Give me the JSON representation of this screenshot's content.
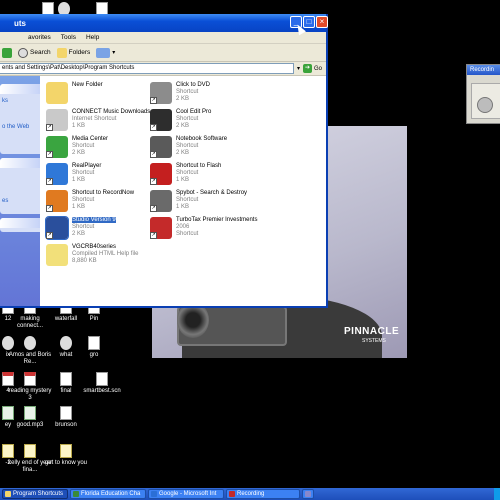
{
  "window": {
    "title_fragment": "uts",
    "menu": [
      "avorites",
      "Tools",
      "Help"
    ],
    "toolbar": {
      "search_label": "Search",
      "folders_label": "Folders"
    },
    "address": "ents and Settings\\Pat\\Desktop\\Program Shortcuts",
    "go_label": "Go",
    "taskpane": {
      "item1": "ks",
      "item2": "o the Web",
      "item3": "es"
    },
    "files": [
      {
        "name": "New Folder",
        "line2": "",
        "line3": "",
        "icon": "folder-icon",
        "color": "#f3d56a"
      },
      {
        "name": "Click to DVD",
        "line2": "Shortcut",
        "line3": "2 KB",
        "icon": "dvd-icon",
        "color": "#8c8c8c"
      },
      {
        "name": "CONNECT Music Downloads",
        "line2": "Internet Shortcut",
        "line3": "1 KB",
        "icon": "music-downloads-icon",
        "color": "#c9c9c9"
      },
      {
        "name": "Cool Edit Pro",
        "line2": "Shortcut",
        "line3": "2 KB",
        "icon": "waveform-icon",
        "color": "#2d2d2d"
      },
      {
        "name": "Media Center",
        "line2": "Shortcut",
        "line3": "2 KB",
        "icon": "media-center-icon",
        "color": "#3aa540"
      },
      {
        "name": "Notebook Software",
        "line2": "Shortcut",
        "line3": "2 KB",
        "icon": "notebook-icon",
        "color": "#5a5a5a"
      },
      {
        "name": "RealPlayer",
        "line2": "Shortcut",
        "line3": "1 KB",
        "icon": "realplayer-icon",
        "color": "#2f78d8"
      },
      {
        "name": "Shortcut to Flash",
        "line2": "Shortcut",
        "line3": "1 KB",
        "icon": "flash-icon",
        "color": "#c41f1f"
      },
      {
        "name": "Shortcut to RecordNow",
        "line2": "Shortcut",
        "line3": "1 KB",
        "icon": "recordnow-icon",
        "color": "#e07a20"
      },
      {
        "name": "Spybot - Search & Destroy",
        "line2": "Shortcut",
        "line3": "1 KB",
        "icon": "spybot-icon",
        "color": "#6a6a6a"
      },
      {
        "name": "Studio Version 9",
        "line2": "Shortcut",
        "line3": "2 KB",
        "icon": "studio-icon",
        "color": "#2a4f9c"
      },
      {
        "name": "TurboTax Premier Investments",
        "line2": "2006",
        "line3": "Shortcut",
        "icon": "turbotax-icon",
        "color": "#c42a2a"
      },
      {
        "name": "VGCRB40series",
        "line2": "Compiled HTML Help file",
        "line3": "8,880 KB",
        "icon": "help-file-icon",
        "color": "#f2e07a"
      }
    ]
  },
  "desktop": {
    "icons": [
      {
        "label": "kelly end of year fina...",
        "icon": "note"
      },
      {
        "label": "get to know you",
        "icon": "note"
      },
      {
        "label": "making connect...",
        "icon": "doc"
      },
      {
        "label": "waterfall",
        "icon": "doc"
      },
      {
        "label": "Pin",
        "icon": "doc"
      },
      {
        "label": "Amos and Boris Re...",
        "icon": "spk"
      },
      {
        "label": "what",
        "icon": "spk"
      },
      {
        "label": "gro",
        "icon": "doc"
      },
      {
        "label": "reading mystery 3",
        "icon": "pdf"
      },
      {
        "label": "final",
        "icon": "doc"
      },
      {
        "label": "smartbest.scn",
        "icon": "doc"
      },
      {
        "label": "good.mp3",
        "icon": "mp3"
      },
      {
        "label": "brunson",
        "icon": "doc"
      }
    ],
    "partial_left_labels": [
      "12",
      "ix",
      "4",
      "ey",
      "-2"
    ]
  },
  "photo": {
    "brand": "PINNACLE",
    "brand_sub": "SYSTEMS"
  },
  "recording": {
    "title": "Recordin"
  },
  "taskbar": {
    "items": [
      {
        "label": "Program Shortcuts",
        "color": "#f3d56a",
        "active": true
      },
      {
        "label": "Florida Education Cha",
        "color": "#3a8a3a",
        "active": false
      },
      {
        "label": "Google - Microsoft Int",
        "color": "#2b6fd6",
        "active": false
      },
      {
        "label": "Recording",
        "color": "#c42a2a",
        "active": false
      },
      {
        "label": "",
        "color": "#8888cc",
        "active": false
      }
    ]
  }
}
